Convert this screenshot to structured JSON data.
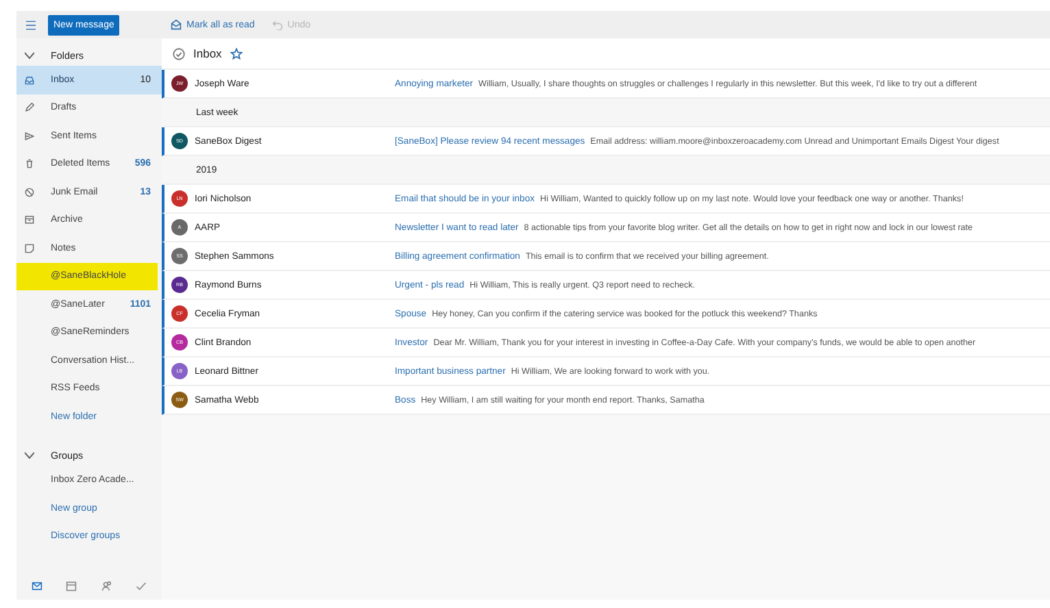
{
  "toolbar": {
    "new_message": "New message",
    "mark_all_read": "Mark all as read",
    "undo": {
      "label": "Undo",
      "disabled": true
    }
  },
  "sidebar": {
    "folders_header": "Folders",
    "folders": [
      {
        "kind": "folder",
        "label": "Inbox",
        "count": "10",
        "selected": true,
        "highlighted": false
      },
      {
        "kind": "folder",
        "label": "Drafts",
        "selected": false,
        "highlighted": false
      },
      {
        "kind": "folder",
        "label": "Sent Items",
        "selected": false,
        "highlighted": false
      },
      {
        "kind": "folder",
        "label": "Deleted Items",
        "count": "596",
        "selected": false,
        "highlighted": false
      },
      {
        "kind": "folder",
        "label": "Junk Email",
        "count": "13",
        "selected": false,
        "highlighted": false
      },
      {
        "kind": "folder",
        "label": "Archive",
        "selected": false,
        "highlighted": false
      },
      {
        "kind": "folder",
        "label": "Notes",
        "selected": false,
        "highlighted": false
      },
      {
        "kind": "folder",
        "label": "@SaneBlackHole",
        "selected": false,
        "highlighted": true
      },
      {
        "kind": "folder",
        "label": "@SaneLater",
        "count": "1101",
        "selected": false,
        "highlighted": false
      },
      {
        "kind": "folder",
        "label": "@SaneReminders",
        "selected": false,
        "highlighted": false
      },
      {
        "kind": "folder",
        "label": "Conversation Hist...",
        "selected": false,
        "highlighted": false
      },
      {
        "kind": "folder",
        "label": "RSS Feeds",
        "selected": false,
        "highlighted": false
      },
      {
        "kind": "link",
        "label": "New folder"
      }
    ],
    "groups_header": "Groups",
    "groups": [
      {
        "kind": "folder",
        "label": "Inbox Zero Acade...",
        "selected": false,
        "highlighted": false
      },
      {
        "kind": "link",
        "label": "New group"
      },
      {
        "kind": "link",
        "label": "Discover groups"
      }
    ],
    "apps": [
      {
        "selected": true
      },
      {
        "selected": false
      },
      {
        "selected": false
      },
      {
        "selected": false
      }
    ]
  },
  "list": {
    "title": "Inbox",
    "rows": [
      {
        "kind": "message",
        "initials": "JW",
        "color": "#7a1f2b",
        "sender": "Joseph Ware",
        "subject": "Annoying marketer",
        "preview": "William, Usually, I share thoughts on struggles or challenges I regularly in this newsletter. But this week, I'd like to try out a different",
        "unread": true
      },
      {
        "kind": "group",
        "label": "Last week"
      },
      {
        "kind": "message",
        "initials": "SD",
        "color": "#0e5763",
        "sender": "SaneBox Digest",
        "subject": "[SaneBox] Please review 94 recent messages",
        "preview": "Email address: william.moore@inboxzeroacademy.com Unread and Unimportant Emails Digest Your digest",
        "unread": true
      },
      {
        "kind": "group",
        "label": "2019"
      },
      {
        "kind": "message",
        "initials": "LN",
        "color": "#c9302c",
        "sender": "Iori Nicholson",
        "subject": "Email that should be in your inbox",
        "preview": "Hi William, Wanted to quickly follow up on my last note. Would love your feedback one way or another. Thanks!",
        "unread": true
      },
      {
        "kind": "message",
        "initials": "A",
        "color": "#696969",
        "sender": "AARP",
        "subject": "Newsletter I want to read later",
        "preview": "8 actionable tips from your favorite blog writer. Get all the details on how to get in right now and lock in our lowest rate",
        "unread": true
      },
      {
        "kind": "message",
        "initials": "SS",
        "color": "#6d6d6d",
        "sender": "Stephen Sammons",
        "subject": "Billing agreement confirmation",
        "preview": "This email is to confirm that we received your billing agreement.",
        "unread": true
      },
      {
        "kind": "message",
        "initials": "RB",
        "color": "#5a2a90",
        "sender": "Raymond Burns",
        "subject": "Urgent - pls read",
        "preview": "Hi William, This is really urgent. Q3 report need to recheck.",
        "unread": true
      },
      {
        "kind": "message",
        "initials": "CF",
        "color": "#c9302c",
        "sender": "Cecelia Fryman",
        "subject": "Spouse",
        "preview": "Hey honey, Can you confirm if the catering service was booked for the potluck this weekend? Thanks",
        "unread": true
      },
      {
        "kind": "message",
        "initials": "CB",
        "color": "#b52a9f",
        "sender": "Clint Brandon",
        "subject": "Investor",
        "preview": "Dear Mr. William, Thank you for your interest in investing in Coffee-a-Day Cafe. With your company's funds, we would be able to open another",
        "unread": true
      },
      {
        "kind": "message",
        "initials": "LB",
        "color": "#8862c6",
        "sender": "Leonard Bittner",
        "subject": "Important business partner",
        "preview": "Hi William, We are looking forward to work with you.",
        "unread": true
      },
      {
        "kind": "message",
        "initials": "SW",
        "color": "#8b5c12",
        "sender": "Samatha Webb",
        "subject": "Boss",
        "preview": "Hey William, I am still waiting for your month end report. Thanks, Samatha",
        "unread": true
      }
    ]
  }
}
